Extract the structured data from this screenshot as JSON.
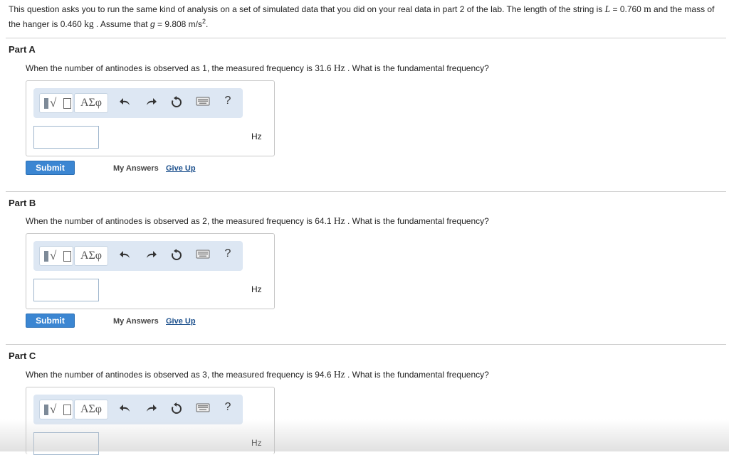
{
  "intro": {
    "text_1": "This question asks you to run the same kind of analysis on a set of simulated data that you did on your real data in part 2 of the lab. The length of the string is",
    "length_var": "L",
    "length_eq": " = 0.760 ",
    "length_unit": "m",
    "text_2": " and the mass of the hanger is 0.460 ",
    "mass_unit": "kg",
    "text_3": " . Assume that ",
    "g_var": "g",
    "g_value": " = 9.808 m/s",
    "g_exp": "2",
    "text_4": "."
  },
  "toolbar": {
    "greek_label": "ΑΣφ",
    "undo_icon": "undo-arrow",
    "redo_icon": "redo-arrow",
    "reset_icon": "reset-circle",
    "keyboard_icon": "keyboard",
    "help_label": "?"
  },
  "parts": [
    {
      "title": "Part A",
      "q_prefix": "When the number of antinodes is observed as 1, the measured frequency is 31.6 ",
      "q_unit": "Hz",
      "q_suffix": " . What is the fundamental frequency?",
      "answer_value": "",
      "unit": "Hz",
      "submit": "Submit",
      "my_answers": "My Answers",
      "give_up": "Give Up"
    },
    {
      "title": "Part B",
      "q_prefix": "When the number of antinodes is observed as 2, the measured frequency is 64.1 ",
      "q_unit": "Hz",
      "q_suffix": " . What is the fundamental frequency?",
      "answer_value": "",
      "unit": "Hz",
      "submit": "Submit",
      "my_answers": "My Answers",
      "give_up": "Give Up"
    },
    {
      "title": "Part C",
      "q_prefix": "When the number of antinodes is observed as 3, the measured frequency is 94.6 ",
      "q_unit": "Hz",
      "q_suffix": " . What is the fundamental frequency?",
      "answer_value": "",
      "unit": "Hz"
    }
  ],
  "colors": {
    "toolbar_bg": "#dde7f3",
    "submit_bg": "#3b86d2",
    "link": "#1b4f8c"
  }
}
